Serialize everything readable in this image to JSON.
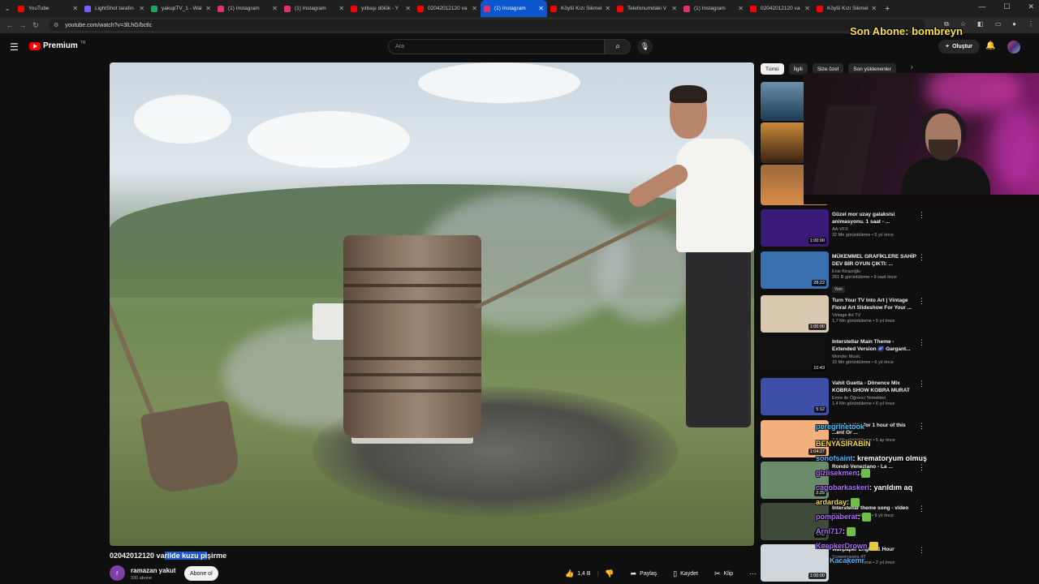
{
  "browser": {
    "tabs": [
      {
        "title": "YouTube",
        "color": "#ff0000"
      },
      {
        "title": "LightShot tarafın",
        "color": "#7b5cff"
      },
      {
        "title": "yakupTV_1 - Wal",
        "color": "#1fa463"
      },
      {
        "title": "(1) Instagram",
        "color": "#e1306c"
      },
      {
        "title": "(1) Instagram",
        "color": "#e1306c"
      },
      {
        "title": "yılbaşı dölük - Y",
        "color": "#ff0000"
      },
      {
        "title": "02042012120 va",
        "color": "#ff0000"
      },
      {
        "title": "(1) Instagram",
        "color": "#e1306c",
        "active": true
      },
      {
        "title": "Köylü Kızı Sikmel",
        "color": "#ff0000"
      },
      {
        "title": "Telefonumdaki V",
        "color": "#ff0000"
      },
      {
        "title": "(1) Instagram",
        "color": "#e1306c"
      },
      {
        "title": "02042012120 va",
        "color": "#ff0000"
      },
      {
        "title": "Köylü Kızı Sikmel",
        "color": "#ff0000"
      }
    ],
    "url": "youtube.com/watch?v=3lLhG/bctlc"
  },
  "header": {
    "logo_text": "Premium",
    "logo_region": "TR",
    "search_placeholder": "Ara",
    "create_label": "Oluştur"
  },
  "overlay": {
    "last_subscriber": "Son Abone: bombreyn"
  },
  "video": {
    "title_before": "02042012120 va",
    "title_highlight": "rilde kuzu pi",
    "title_after": "şirme",
    "channel_initial": "r",
    "channel_name": "ramazan yakut",
    "subscribers": "330 abone",
    "subscribe_label": "Abone ol",
    "likes": "1,4 B",
    "share_label": "Paylaş",
    "save_label": "Kaydet",
    "clip_label": "Klip"
  },
  "sidebar": {
    "chips": [
      "Tümü",
      "İlgili",
      "Size özel",
      "Son yüklenenler"
    ],
    "recommendations": [
      {
        "title": "Güzel mor uzay galaksisi animasyonu. 1 saat - ...",
        "channel": "AA-VFX",
        "verified": true,
        "meta": "32 Mn görüntüleme • 5 yıl önce",
        "duration": "1:00:00",
        "thumb_color": "#3a1a78"
      },
      {
        "title": "MÜKEMMEL GRAFİKLERE SAHİP DEV BİR OYUN ÇIKTI: ...",
        "channel": "Enis Kirazoğlu",
        "verified": true,
        "meta": "281 B görüntüleme • 9 saat önce",
        "badge": "Yeni",
        "duration": "28:22",
        "thumb_color": "#3a6fb0"
      },
      {
        "title": "Turn Your TV Into Art | Vintage Floral Art Slideshow For Your ...",
        "channel": "Vintage Art TV",
        "verified": false,
        "meta": "1,7 Mn görüntüleme • 5 yıl önce",
        "duration": "1:00:00",
        "thumb_color": "#d9c9b0"
      },
      {
        "title": "Interstellar Main Theme - Extended Version 🌌 Gargant...",
        "channel": "Wonder Music",
        "verified": false,
        "meta": "15 Mn görüntüleme • 6 yıl önce",
        "duration": "10:43",
        "thumb_color": "#111111"
      },
      {
        "title": "Vahit Guetta - Dönence Mix KOBRA SHOW KOBRA MURAT",
        "channel": "Emre ile Öğrenci Yemekleri",
        "verified": false,
        "meta": "1,4 Mn görüntüleme • 6 yıl önce",
        "duration": "5:12",
        "thumb_color": "#3d4fa8"
      },
      {
        "title": "watch beige for 1 hour of this ...ent Or ...",
        "channel": "",
        "verified": false,
        "meta": "2,5 Mn görüntüleme • 5 ay önce",
        "duration": "1:04:27",
        "thumb_color": "#f4b07c"
      },
      {
        "title": "Rondò Veneziano - La ...",
        "channel": "randomVHSfan",
        "verified": false,
        "meta": "",
        "duration": "2:29",
        "thumb_color": "#6b8c6a"
      },
      {
        "title": "Interstellar theme song - video",
        "channel": "",
        "verified": false,
        "meta": "38 Mn görüntüleme • 9 yıl önce",
        "duration": "4:43",
        "thumb_color": "#3e4a3a"
      },
      {
        "title": "Wallpaper Engine 1 Hour",
        "channel": "Screensavers 4T",
        "verified": false,
        "meta": "4,8 Mn görüntüleme • 2 yıl önce",
        "duration": "1:00:00",
        "thumb_color": "#cfd6dc"
      }
    ]
  },
  "chat": [
    {
      "user": "peregrinetook",
      "color": "#38c8ff",
      "msg": ""
    },
    {
      "user": "BENYASİRABİN",
      "color": "#f7d84a",
      "msg": ""
    },
    {
      "user": "sonofsaint",
      "color": "#4fb4ff",
      "msg": ": krematoryum olmuş"
    },
    {
      "user": "gizlisekmen",
      "color": "#b26cff",
      "msg": ":"
    },
    {
      "user": "cagobarkaskeri",
      "color": "#b26cff",
      "msg": ": yarıldım aq"
    },
    {
      "user": "ardarday",
      "color": "#f7d84a",
      "msg": ":"
    },
    {
      "user": "pompaberat",
      "color": "#b26cff",
      "msg": ":"
    },
    {
      "user": "Arnl717",
      "color": "#b26cff",
      "msg": ":"
    },
    {
      "user": "KeepkerDrown",
      "color": "#b26cff",
      "msg": ""
    },
    {
      "user": "Kacakemr",
      "color": "#4fb4ff",
      "msg": ""
    }
  ]
}
